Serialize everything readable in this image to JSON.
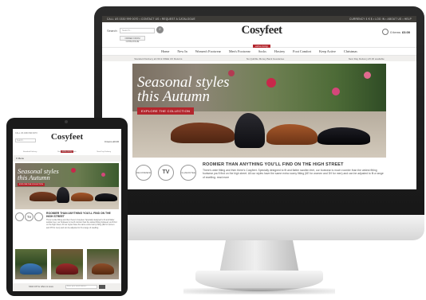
{
  "desktop": {
    "topbar": {
      "left": "CALL US 0330 999 0070   •   CONTACT US   •   REQUEST A CATALOGUE",
      "right": "CURRENCY  £  €  $   •   LOG IN   •   ABOUT US   •   HELP"
    },
    "search": {
      "label": "Search",
      "placeholder": "Search...",
      "order_button": "ORDER FROM CATALOGUE"
    },
    "logo": {
      "text": "Cosyfeet",
      "tagline": "extra roomy"
    },
    "basket": {
      "items": "0 items",
      "total": "£0.00"
    },
    "nav": [
      "Home",
      "New In",
      "Women's Footwear",
      "Men's Footwear",
      "Socks",
      "Hosiery",
      "Foot Comfort",
      "Keep Active",
      "Christmas"
    ],
    "strip": [
      "Standard Delivery £4.99 & FREE UK Returns",
      "No Quibble Money Back Guarantee",
      "Next Day Delivery £5.00 available"
    ],
    "hero": {
      "line1": "Seasonal styles",
      "line2": "this Autumn",
      "button": "EXPLORE THE COLLECTION"
    },
    "badges": [
      "RECOMMENDED",
      "TV",
      "GUARANTEE"
    ],
    "headline": "ROOMIER THAN ANYTHING YOU'LL FIND ON THE HIGH STREET",
    "body": "There's wide fitting and then there's Cosyfeet. Specially designed to fit and flatter swollen feet, our footwear is much roomier than the widest fitting footwear you'll find on the high street. All our styles have the same extra roomy fitting (6E for women and 3H for men) and can be adjusted to fit a range of swelling. read more"
  },
  "tablet": {
    "topline": "CALL US 0330 999 0070",
    "search_placeholder": "Search...",
    "logo": {
      "text": "Cosyfeet",
      "tagline": "extra roomy"
    },
    "basket": "0 items £0.00",
    "strip": [
      "Standard Delivery",
      "No Quibble Money Back",
      "Next Day Delivery"
    ],
    "menu": "≡  Menu",
    "hero": {
      "line1": "Seasonal styles",
      "line2": "this Autumn",
      "button": "EXPLORE THE COLLECTION"
    },
    "badges": [
      "",
      "TV",
      ""
    ],
    "headline": "ROOMIER THAN ANYTHING YOU'LL FIND ON THE HIGH STREET",
    "body": "There's wide fitting and then there's Cosyfeet. Specially designed to fit and flatter swollen feet, our footwear is much roomier than the widest fitting footwear you'll find on the high street. All our styles have the same extra roomy fitting (6E for women and 3H for men) and can be adjusted to fit a range of swelling.",
    "newsletter": "SIGN UP for offers & news",
    "newsletter_placeholder": "Enter your email address"
  },
  "colors": {
    "brand_red": "#b3262d",
    "topbar": "#3d3b37"
  }
}
